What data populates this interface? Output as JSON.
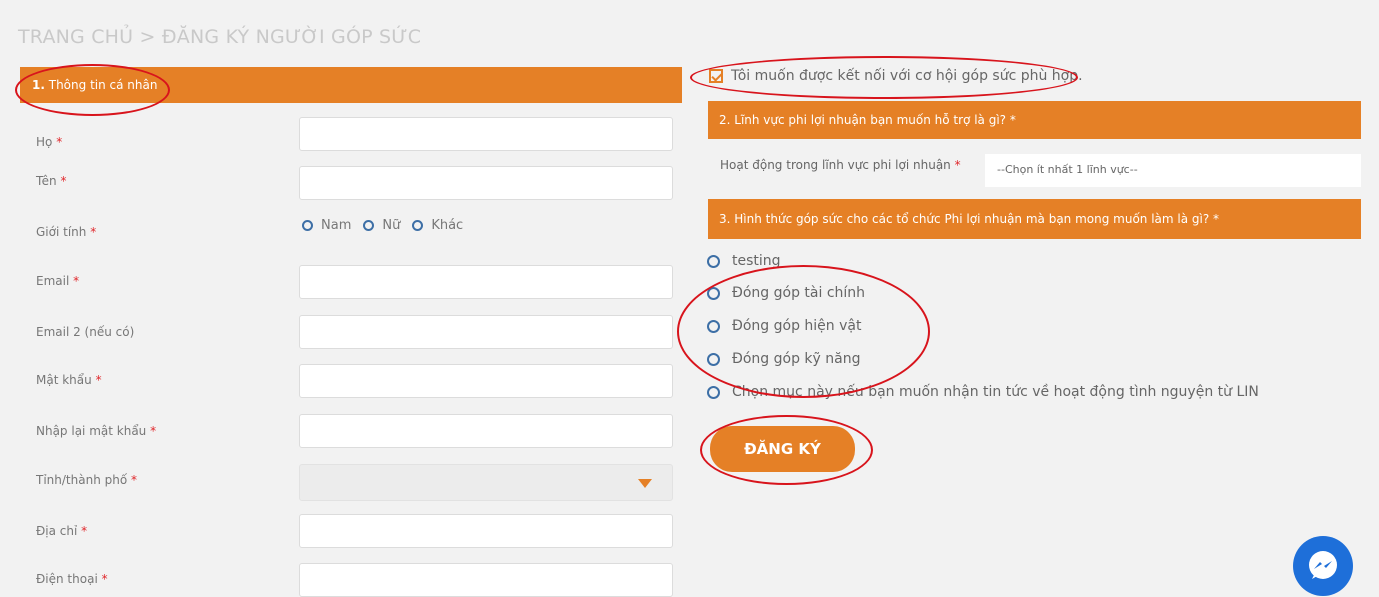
{
  "breadcrumb": "TRANG CHỦ > ĐĂNG KÝ NGƯỜI GÓP SỨC",
  "section1": {
    "number": "1.",
    "title": "Thông tin cá nhân"
  },
  "required_mark": "*",
  "fields": {
    "ho": "Họ",
    "ten": "Tên",
    "gioitinh": "Giới tính",
    "email": "Email",
    "email2": "Email 2 (nếu có)",
    "matkhau": "Mật khẩu",
    "nhaplai": "Nhập lại mật khẩu",
    "tinh": "Tỉnh/thành phố",
    "diachi": "Địa chỉ",
    "dienthoai": "Điện thoại"
  },
  "gender_options": [
    "Nam",
    "Nữ",
    "Khác"
  ],
  "connect_checkbox": {
    "label": "Tôi muốn được kết nối với cơ hội góp sức phù hợp.",
    "checked": true
  },
  "section2": {
    "title": "2. Lĩnh vực phi lợi nhuận bạn muốn hỗ trợ là gì? *"
  },
  "field_area": {
    "label": "Hoạt động trong lĩnh vực phi lợi nhuận",
    "placeholder": "--Chọn ít nhất 1 lĩnh vực--"
  },
  "section3": {
    "title": "3. Hình thức góp sức cho các tổ chức Phi lợi nhuận mà bạn mong muốn làm là gì? *"
  },
  "contribution_options": [
    "testing",
    "Đóng góp tài chính",
    "Đóng góp hiện vật",
    "Đóng góp kỹ năng",
    "Chọn mục này nếu bạn muốn nhận tin tức về hoạt động tình nguyện từ LIN"
  ],
  "submit_label": "ĐĂNG KÝ",
  "colors": {
    "accent": "#e58026",
    "annotation": "#d8141c",
    "radio": "#3d6fa6",
    "messenger": "#1e6fd9"
  },
  "icons": {
    "messenger": "messenger-icon",
    "dropdown": "caret-down-icon",
    "checkbox": "checkmark-icon"
  }
}
